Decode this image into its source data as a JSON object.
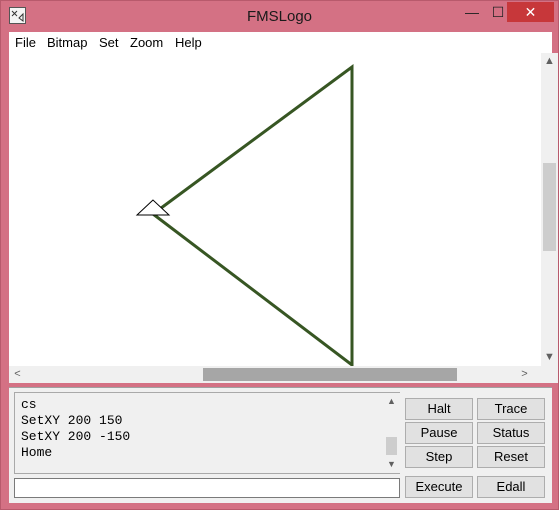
{
  "window": {
    "title": "FMSLogo",
    "minimize_glyph": "—",
    "maximize_glyph": "☐",
    "close_glyph": "✕"
  },
  "menu": [
    "File",
    "Bitmap",
    "Set",
    "Zoom",
    "Help"
  ],
  "canvas": {
    "turtle_icon": "triangle-turtle-icon",
    "pen_color": "#375623",
    "scroll_up_glyph": "▲",
    "scroll_down_glyph": "▼",
    "scroll_left_glyph": "<",
    "scroll_right_glyph": ">"
  },
  "commander": {
    "history_lines": [
      "cs",
      "SetXY 200 150",
      "SetXY 200 -150",
      "Home"
    ],
    "input_value": "",
    "scroll_up_glyph": "▲",
    "scroll_down_glyph": "▼",
    "buttons": {
      "halt": "Halt",
      "trace": "Trace",
      "pause": "Pause",
      "status": "Status",
      "step": "Step",
      "reset": "Reset",
      "execute": "Execute",
      "edall": "Edall"
    }
  }
}
